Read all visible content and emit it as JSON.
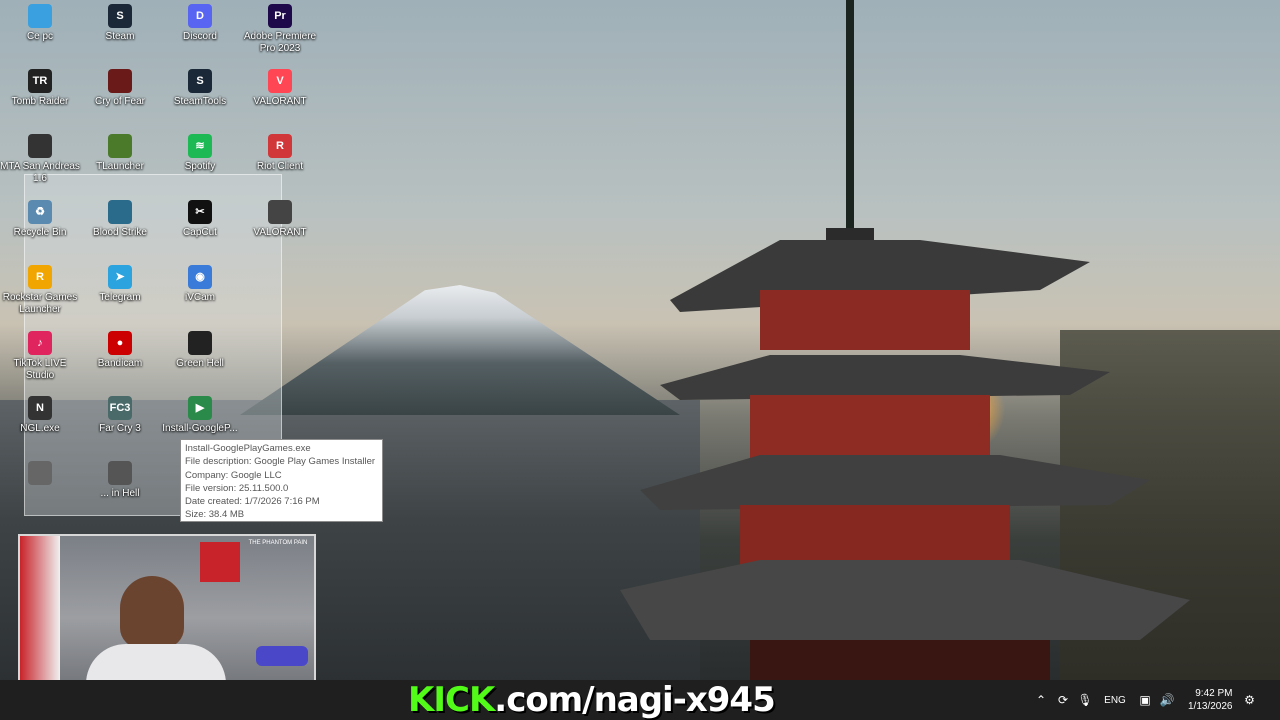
{
  "desktop_icons": [
    {
      "label": "Ce pc",
      "glyph": "",
      "color": "#3aa0e0"
    },
    {
      "label": "Steam",
      "glyph": "S",
      "color": "#1b2838"
    },
    {
      "label": "Discord",
      "glyph": "D",
      "color": "#5865f2"
    },
    {
      "label": "Adobe Premiere Pro 2023",
      "glyph": "Pr",
      "color": "#1e0a4a"
    },
    {
      "label": "Tomb Raider",
      "glyph": "TR",
      "color": "#222"
    },
    {
      "label": "Cry of Fear",
      "glyph": "",
      "color": "#6b1a1a"
    },
    {
      "label": "SteamTools",
      "glyph": "S",
      "color": "#1b2838"
    },
    {
      "label": "VALORANT",
      "glyph": "V",
      "color": "#ff4655"
    },
    {
      "label": "MTA San Andreas 1.6",
      "glyph": "",
      "color": "#333"
    },
    {
      "label": "TLauncher",
      "glyph": "",
      "color": "#4a7a2a"
    },
    {
      "label": "Spotify",
      "glyph": "≋",
      "color": "#1db954"
    },
    {
      "label": "Riot Client",
      "glyph": "R",
      "color": "#d13639"
    },
    {
      "label": "Recycle Bin",
      "glyph": "♻",
      "color": "#5a8ab0"
    },
    {
      "label": "Blood Strike",
      "glyph": "",
      "color": "#2a6a8a"
    },
    {
      "label": "CapCut",
      "glyph": "✂",
      "color": "#111"
    },
    {
      "label": "VALORANT",
      "glyph": "",
      "color": "#444"
    },
    {
      "label": "Rockstar Games Launcher",
      "glyph": "R",
      "color": "#f0a500"
    },
    {
      "label": "Telegram",
      "glyph": "➤",
      "color": "#2aa3df"
    },
    {
      "label": "iVCam",
      "glyph": "◉",
      "color": "#3a7ad8"
    },
    {
      "label": "TikTok LIVE Studio",
      "glyph": "♪",
      "color": "#e0245e"
    },
    {
      "label": "Bandicam",
      "glyph": "●",
      "color": "#c00"
    },
    {
      "label": "Green Hell",
      "glyph": "",
      "color": "#222"
    },
    {
      "label": "NGL.exe",
      "glyph": "N",
      "color": "#333"
    },
    {
      "label": "Far Cry 3",
      "glyph": "FC3",
      "color": "#4a6a6a"
    },
    {
      "label": "Install-GoogleP...",
      "glyph": "▶",
      "color": "#2a8a4a"
    },
    {
      "label": "",
      "glyph": "",
      "color": "#666"
    },
    {
      "label": "... in Hell",
      "glyph": "",
      "color": "#555"
    }
  ],
  "tooltip": {
    "line1": "Install-GooglePlayGames.exe",
    "line2": "File description: Google Play Games Installer",
    "line3": "Company: Google LLC",
    "line4": "File version: 25.11.500.0",
    "line5": "Date created: 1/7/2026 7:16 PM",
    "line6": "Size: 38.4 MB"
  },
  "webcam": {
    "banner": "THE PHANTOM PAIN"
  },
  "stream_overlay": {
    "kick": "KICK",
    "rest": ".com/nagi-x945"
  },
  "taskbar": {
    "language": "ENG",
    "time": "9:42 PM",
    "date": "1/13/2026"
  },
  "colors": {
    "kick_green": "#53fc18",
    "taskbar_bg": "#1f1f1f"
  }
}
